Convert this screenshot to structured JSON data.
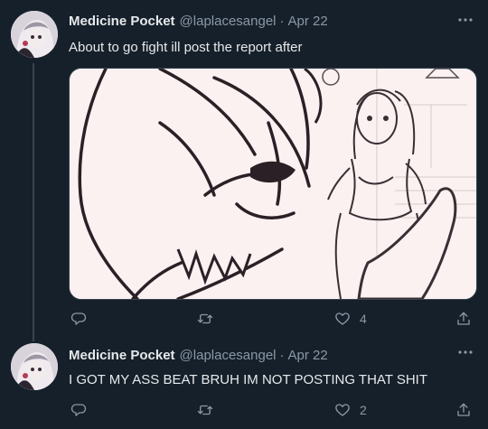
{
  "tweets": [
    {
      "author_name": "Medicine Pocket",
      "handle": "@laplacesangel",
      "separator": "·",
      "date": "Apr 22",
      "text": "About to go fight ill post the report after",
      "likes": "4",
      "has_media": true
    },
    {
      "author_name": "Medicine Pocket",
      "handle": "@laplacesangel",
      "separator": "·",
      "date": "Apr 22",
      "text": "I GOT MY ASS BEAT BRUH IM NOT POSTING THAT SHIT",
      "likes": "2",
      "has_media": false
    }
  ],
  "icons": {
    "more": "more-horizontal-icon",
    "reply": "reply-icon",
    "retweet": "retweet-icon",
    "like": "heart-icon",
    "share": "share-icon"
  },
  "colors": {
    "background": "#15202b",
    "text": "#e7e9ea",
    "secondary": "#8b98a5",
    "border": "#38444d"
  }
}
